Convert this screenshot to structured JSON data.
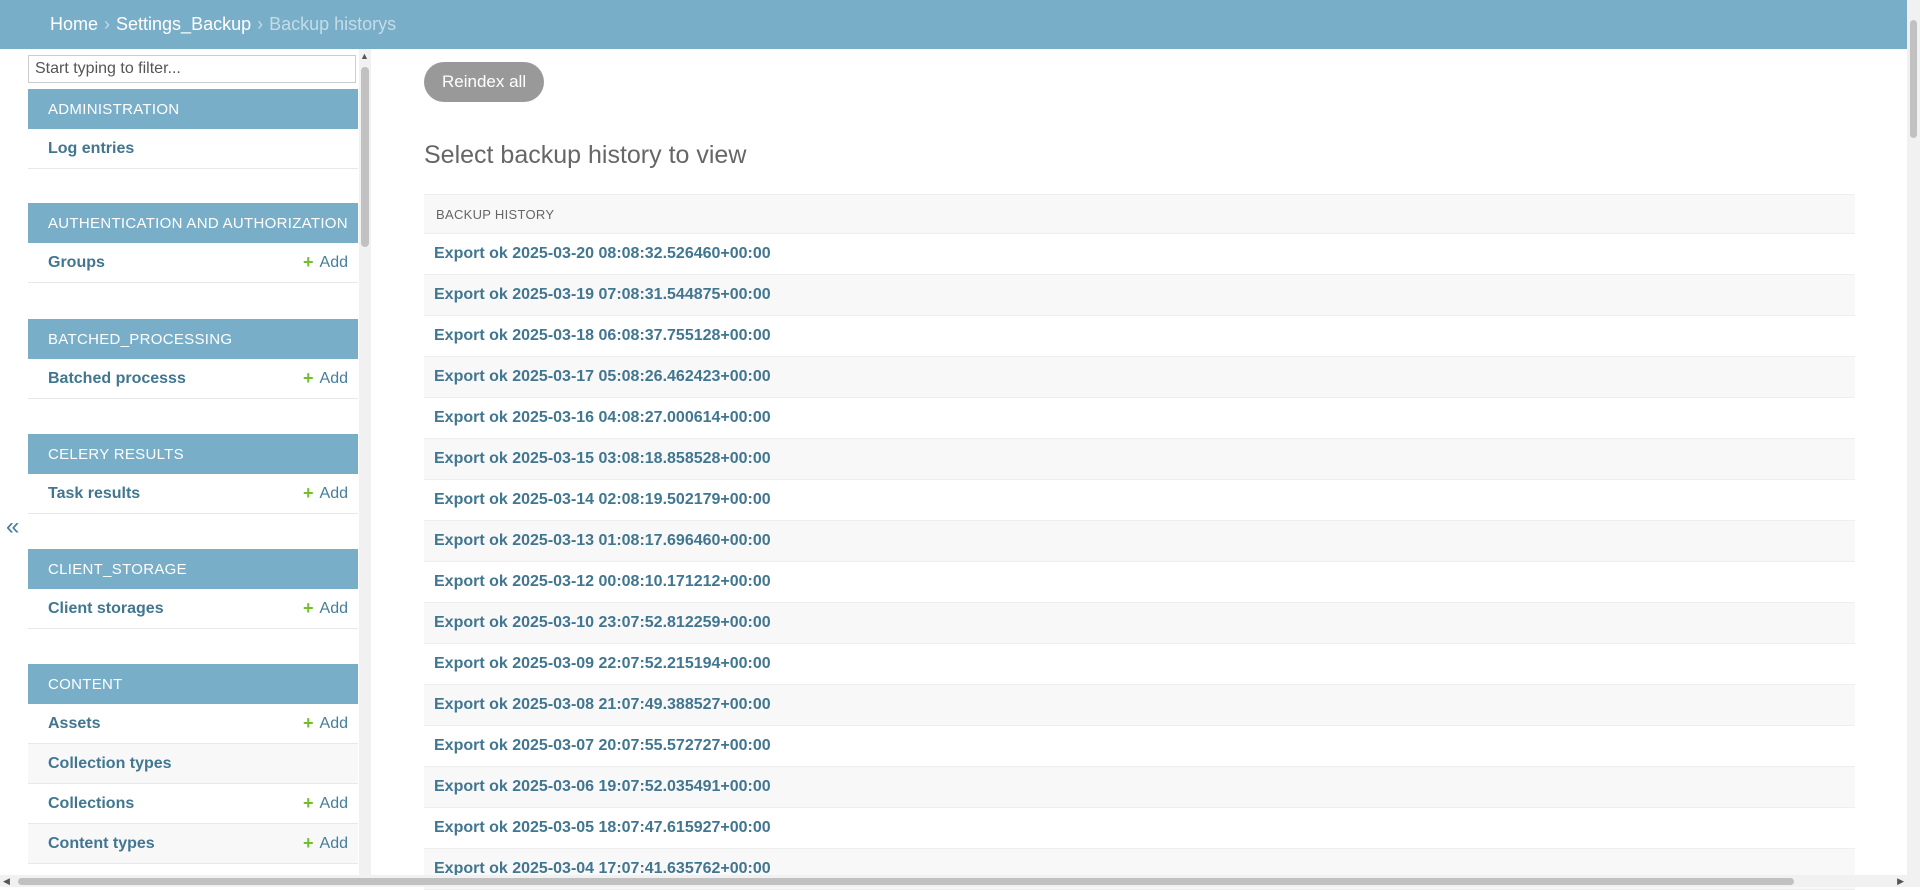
{
  "breadcrumb": {
    "home": "Home",
    "app": "Settings_Backup",
    "current": "Backup historys",
    "separator": "›"
  },
  "sidebar": {
    "filter_placeholder": "Start typing to filter...",
    "add_label": "Add",
    "collapse_glyph": "«",
    "modules": [
      {
        "title": "ADMINISTRATION",
        "models": [
          {
            "name": "Log entries",
            "add": false
          }
        ]
      },
      {
        "title": "AUTHENTICATION AND AUTHORIZATION",
        "models": [
          {
            "name": "Groups",
            "add": true
          }
        ]
      },
      {
        "title": "BATCHED_PROCESSING",
        "models": [
          {
            "name": "Batched processs",
            "add": true
          }
        ]
      },
      {
        "title": "CELERY RESULTS",
        "models": [
          {
            "name": "Task results",
            "add": true
          }
        ]
      },
      {
        "title": "CLIENT_STORAGE",
        "models": [
          {
            "name": "Client storages",
            "add": true
          }
        ]
      },
      {
        "title": "CONTENT",
        "models": [
          {
            "name": "Assets",
            "add": true
          },
          {
            "name": "Collection types",
            "add": false
          },
          {
            "name": "Collections",
            "add": true
          },
          {
            "name": "Content types",
            "add": true
          }
        ]
      }
    ]
  },
  "main": {
    "reindex_label": "Reindex all",
    "title": "Select backup history to view",
    "table_header": "BACKUP HISTORY",
    "rows": [
      "Export ok 2025-03-20 08:08:32.526460+00:00",
      "Export ok 2025-03-19 07:08:31.544875+00:00",
      "Export ok 2025-03-18 06:08:37.755128+00:00",
      "Export ok 2025-03-17 05:08:26.462423+00:00",
      "Export ok 2025-03-16 04:08:27.000614+00:00",
      "Export ok 2025-03-15 03:08:18.858528+00:00",
      "Export ok 2025-03-14 02:08:19.502179+00:00",
      "Export ok 2025-03-13 01:08:17.696460+00:00",
      "Export ok 2025-03-12 00:08:10.171212+00:00",
      "Export ok 2025-03-10 23:07:52.812259+00:00",
      "Export ok 2025-03-09 22:07:52.215194+00:00",
      "Export ok 2025-03-08 21:07:49.388527+00:00",
      "Export ok 2025-03-07 20:07:55.572727+00:00",
      "Export ok 2025-03-06 19:07:52.035491+00:00",
      "Export ok 2025-03-05 18:07:47.615927+00:00",
      "Export ok 2025-03-04 17:07:41.635762+00:00"
    ]
  },
  "colors": {
    "header_bg": "#79aec8",
    "link": "#417690",
    "add_plus": "#70bf2b",
    "button_bg": "#999999"
  }
}
